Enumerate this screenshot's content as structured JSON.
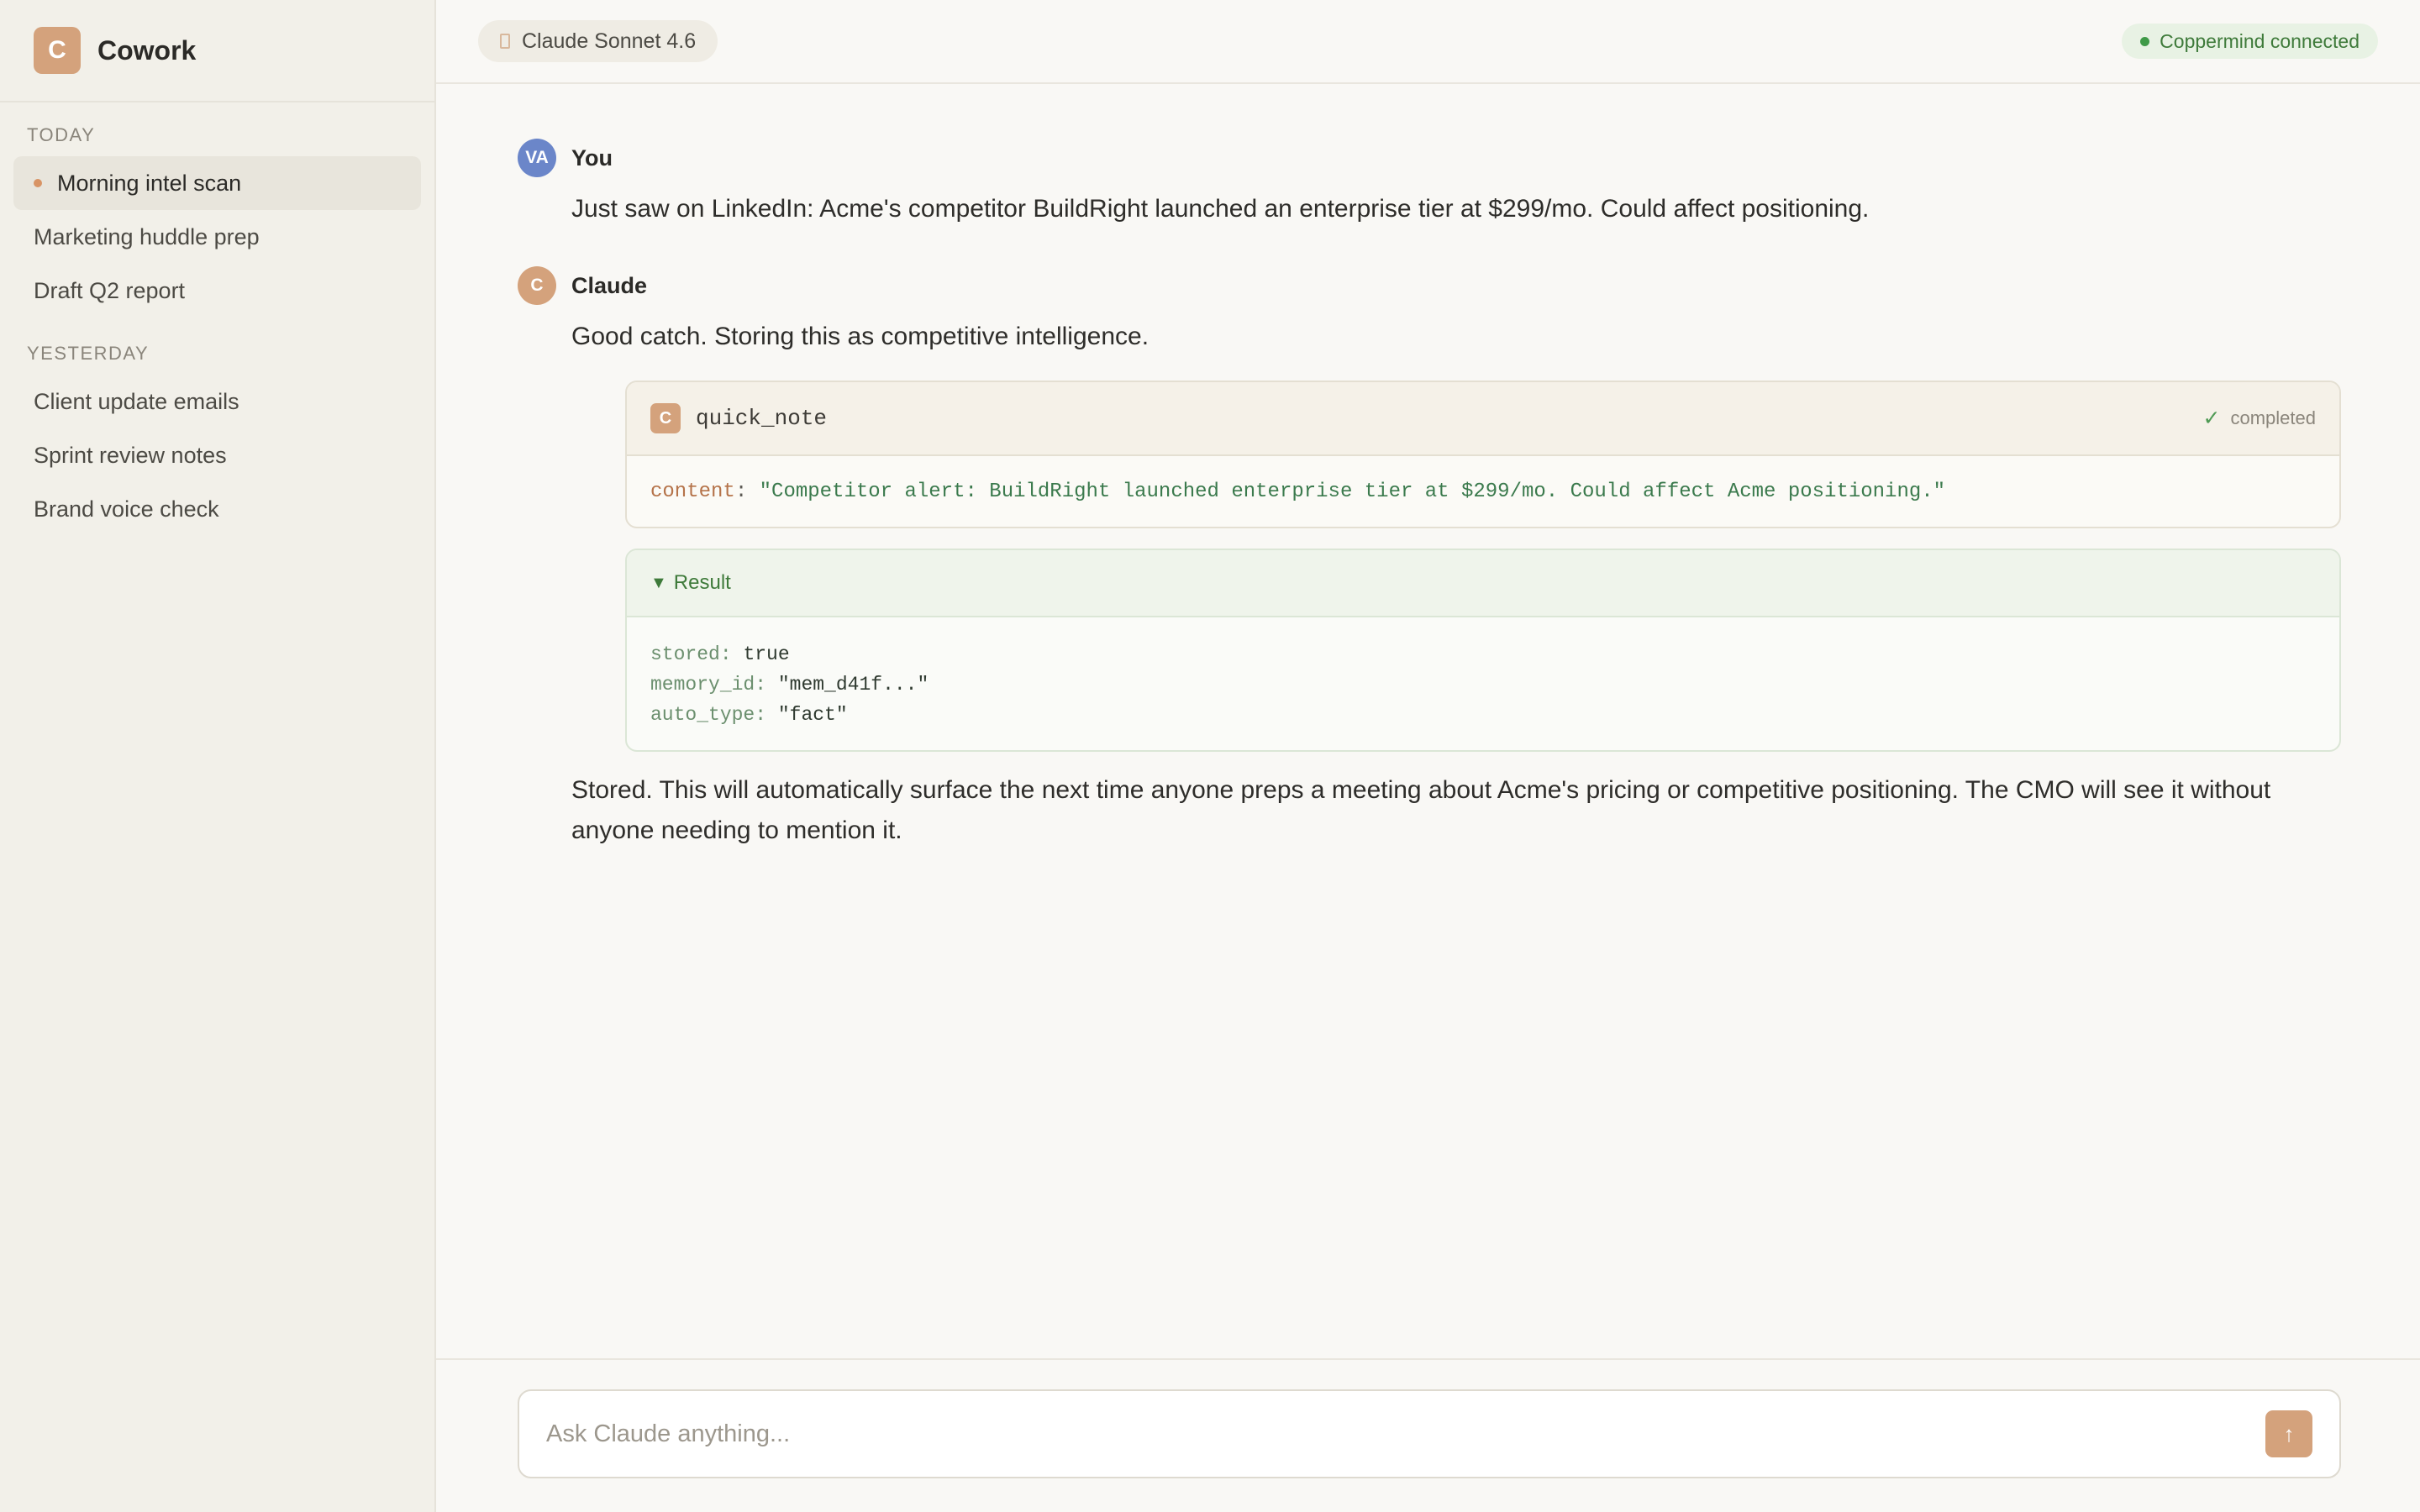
{
  "brand": {
    "logo_letter": "C",
    "name": "Cowork"
  },
  "sidebar": {
    "sections": [
      {
        "label": "TODAY",
        "items": [
          "Morning intel scan",
          "Marketing huddle prep",
          "Draft Q2 report"
        ]
      },
      {
        "label": "YESTERDAY",
        "items": [
          "Client update emails",
          "Sprint review notes",
          "Brand voice check"
        ]
      }
    ],
    "active_item": "Morning intel scan"
  },
  "topbar": {
    "model": "Claude Sonnet 4.6",
    "connection": "Coppermind connected"
  },
  "messages": {
    "user": {
      "avatar": "VA",
      "author": "You",
      "text": "Just saw on LinkedIn: Acme's competitor BuildRight launched an enterprise tier at $299/mo. Could affect positioning."
    },
    "claude": {
      "avatar": "C",
      "author": "Claude",
      "intro": "Good catch. Storing this as competitive intelligence.",
      "tool": {
        "icon_letter": "C",
        "name": "quick_note",
        "status": "completed",
        "arg_key": "content",
        "arg_value": "\"Competitor alert: BuildRight launched enterprise tier at $299/mo. Could affect Acme positioning.\""
      },
      "result": {
        "label": "Result",
        "lines": [
          {
            "key": "stored",
            "value": "true"
          },
          {
            "key": "memory_id",
            "value": "\"mem_d41f...\""
          },
          {
            "key": "auto_type",
            "value": "\"fact\""
          }
        ]
      },
      "final": "Stored. This will automatically surface the next time anyone preps a meeting about Acme's pricing or competitive positioning. The CMO will see it without anyone needing to mention it."
    }
  },
  "composer": {
    "placeholder": "Ask Claude anything...",
    "send_icon": "arrow-up-icon"
  },
  "colors": {
    "accent": "#d4a27c",
    "user_avatar": "#6b86c9",
    "success": "#3f9a48",
    "sidebar_bg": "#f2f0e9",
    "main_bg": "#f9f8f5"
  }
}
